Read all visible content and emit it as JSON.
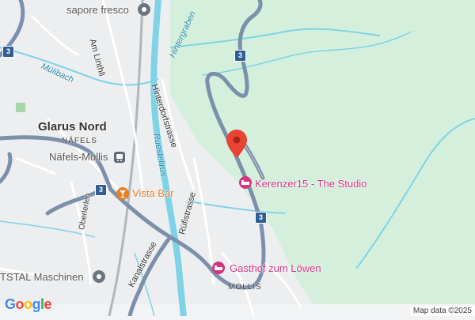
{
  "map": {
    "places": {
      "glarus_nord": "Glarus Nord",
      "nafels": "NÄFELS",
      "mollis": "MOLLIS",
      "nafels_mollis_station": "Näfels-Mollis"
    },
    "streets": {
      "am_linthli": "Am Linthli",
      "hinterdorfstrasse": "Hinterdorfstrasse",
      "hintergraben": "Hintergraben",
      "ruestelirus": "Ruestelirus",
      "ruefistrasse": "Rüfistrasse",
      "kanalstrasse": "Kanalstrasse",
      "oberlerlen": "Oberlerlen"
    },
    "water": {
      "muhlbach": "Mülibach"
    },
    "pois": {
      "sapore_fresco": "sapore fresco",
      "vista_bar": "Vista Bar",
      "kerenzer15": "Kerenzer15 - The Studio",
      "gasthof": "Gasthof zum Löwen",
      "maschinen": "TSTAL Maschinen"
    },
    "route_shields": [
      "3",
      "3",
      "3",
      "3"
    ],
    "selected_pin": "red-location-pin",
    "attribution": "Map data ©2025",
    "logo": "Google",
    "colors": {
      "forest": "#d4f0dc",
      "road": "#7b90ab",
      "water": "#7fd3e6",
      "pin": "#ea4335",
      "poi_pink": "#d63384",
      "poi_orange": "#e67e22"
    }
  }
}
